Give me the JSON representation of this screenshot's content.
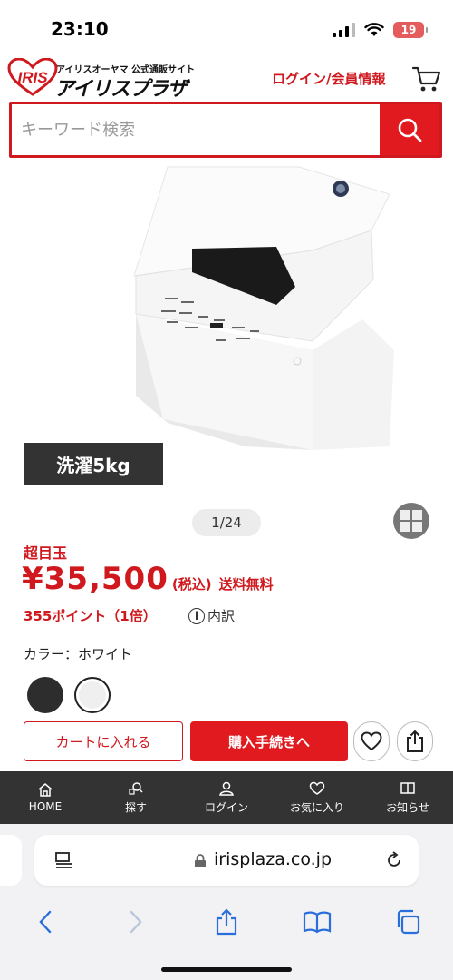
{
  "status": {
    "time": "23:10",
    "battery": "19"
  },
  "header": {
    "logo_line1": "アイリスオーヤマ 公式通販サイト",
    "logo_line2": "アイリスプラザ",
    "login": "ログイン/会員情報"
  },
  "search": {
    "placeholder": "キーワード検索"
  },
  "gallery": {
    "caption": "洗濯5kg",
    "pager": "1/24"
  },
  "product": {
    "sale_label": "超目玉",
    "price": "¥35,500",
    "tax": "(税込)",
    "shipping": "送料無料",
    "points": "355ポイント（1倍）",
    "breakdown": "内訳",
    "color_label": "カラー：ホワイト",
    "colors": [
      "#2d2d2d",
      "#efefef"
    ],
    "selected_color_index": 1
  },
  "actions": {
    "cart": "カートに入れる",
    "buy": "購入手続きへ"
  },
  "bottom_nav": [
    {
      "label": "HOME",
      "icon": "home-icon"
    },
    {
      "label": "探す",
      "icon": "search-icon"
    },
    {
      "label": "ログイン",
      "icon": "user-icon"
    },
    {
      "label": "お気に入り",
      "icon": "heart-icon"
    },
    {
      "label": "お知らせ",
      "icon": "book-icon"
    }
  ],
  "browser": {
    "url": "irisplaza.co.jp"
  },
  "colors": {
    "brand_red": "#d0191e",
    "dark": "#333333"
  }
}
